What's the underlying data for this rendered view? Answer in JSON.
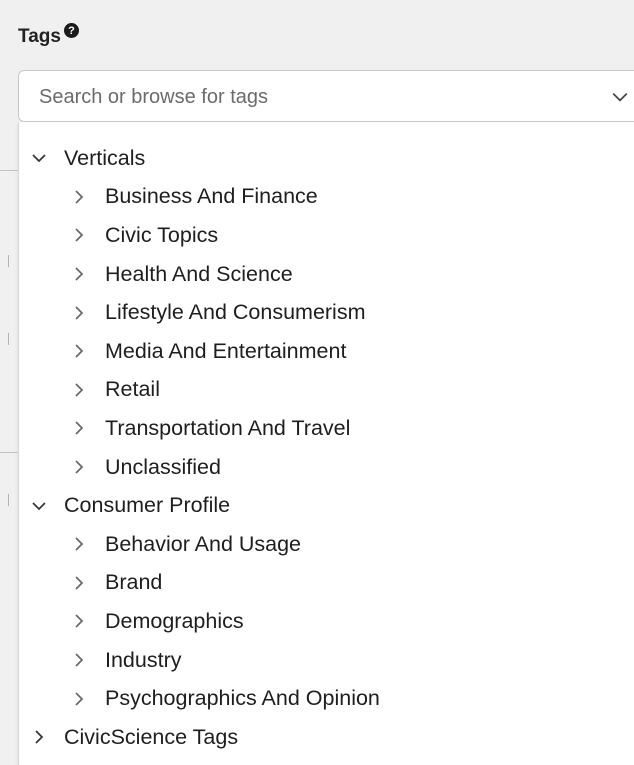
{
  "field": {
    "label": "Tags",
    "help_icon": "?"
  },
  "search": {
    "placeholder": "Search or browse for tags"
  },
  "tree": [
    {
      "label": "Verticals",
      "level": 0,
      "expanded": true
    },
    {
      "label": "Business And Finance",
      "level": 1,
      "expanded": false
    },
    {
      "label": "Civic Topics",
      "level": 1,
      "expanded": false
    },
    {
      "label": "Health And Science",
      "level": 1,
      "expanded": false
    },
    {
      "label": "Lifestyle And Consumerism",
      "level": 1,
      "expanded": false
    },
    {
      "label": "Media And Entertainment",
      "level": 1,
      "expanded": false
    },
    {
      "label": "Retail",
      "level": 1,
      "expanded": false
    },
    {
      "label": "Transportation And Travel",
      "level": 1,
      "expanded": false
    },
    {
      "label": "Unclassified",
      "level": 1,
      "expanded": false
    },
    {
      "label": "Consumer Profile",
      "level": 0,
      "expanded": true
    },
    {
      "label": "Behavior And Usage",
      "level": 1,
      "expanded": false
    },
    {
      "label": "Brand",
      "level": 1,
      "expanded": false
    },
    {
      "label": "Demographics",
      "level": 1,
      "expanded": false
    },
    {
      "label": "Industry",
      "level": 1,
      "expanded": false
    },
    {
      "label": "Psychographics And Opinion",
      "level": 1,
      "expanded": false
    },
    {
      "label": "CivicScience Tags",
      "level": 0,
      "expanded": false
    }
  ]
}
